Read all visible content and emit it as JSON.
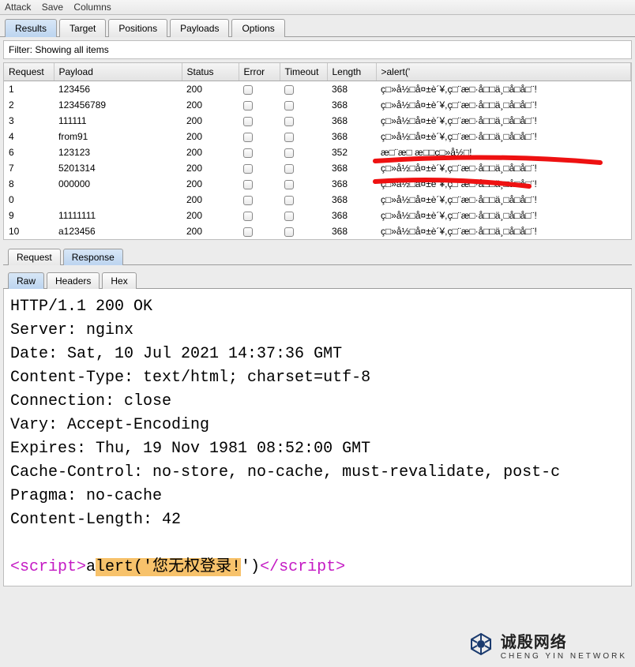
{
  "menu": {
    "items": [
      "Attack",
      "Save",
      "Columns"
    ]
  },
  "tabs": {
    "items": [
      "Results",
      "Target",
      "Positions",
      "Payloads",
      "Options"
    ],
    "active": 0
  },
  "filter": {
    "text": "Filter: Showing all items"
  },
  "columns": [
    "Request",
    "Payload",
    "Status",
    "Error",
    "Timeout",
    "Length",
    ">alert('"
  ],
  "rows": [
    {
      "request": "1",
      "payload": "123456",
      "status": "200",
      "length": "368",
      "alert": "ç□»å½□å¤±è´¥,ç□¨æ□·å□□ä¸□å­□å□¨!"
    },
    {
      "request": "2",
      "payload": "123456789",
      "status": "200",
      "length": "368",
      "alert": "ç□»å½□å¤±è´¥,ç□¨æ□·å□□ä¸□å­□å□¨!"
    },
    {
      "request": "3",
      "payload": "111111",
      "status": "200",
      "length": "368",
      "alert": "ç□»å½□å¤±è´¥,ç□¨æ□·å□□ä¸□å­□å□¨!"
    },
    {
      "request": "4",
      "payload": "from91",
      "status": "200",
      "length": "368",
      "alert": "ç□»å½□å¤±è´¥,ç□¨æ□·å□□ä¸□å­□å□¨!"
    },
    {
      "request": "6",
      "payload": "123123",
      "status": "200",
      "length": "352",
      "alert": "æ□¨æ□ æ□□ç□»å½□!"
    },
    {
      "request": "7",
      "payload": "5201314",
      "status": "200",
      "length": "368",
      "alert": "ç□»å½□å¤±è´¥,ç□¨æ□·å□□ä¸□å­□å□¨!"
    },
    {
      "request": "8",
      "payload": "000000",
      "status": "200",
      "length": "368",
      "alert": "ç□»å½□å¤±è´¥,ç□¨æ□·å□□ä¸□å­□å□¨!"
    },
    {
      "request": "0",
      "payload": "",
      "status": "200",
      "length": "368",
      "alert": "ç□»å½□å¤±è´¥,ç□¨æ□·å□□ä¸□å­□å□¨!"
    },
    {
      "request": "9",
      "payload": "11111111",
      "status": "200",
      "length": "368",
      "alert": "ç□»å½□å¤±è´¥,ç□¨æ□·å□□ä¸□å­□å□¨!"
    },
    {
      "request": "10",
      "payload": "a123456",
      "status": "200",
      "length": "368",
      "alert": "ç□»å½□å¤±è´¥,ç□¨æ□·å□□ä¸□å­□å□¨!"
    }
  ],
  "lower_tabs": {
    "items": [
      "Request",
      "Response"
    ],
    "active": 1
  },
  "view_tabs": {
    "items": [
      "Raw",
      "Headers",
      "Hex"
    ],
    "active": 0
  },
  "response": {
    "lines": [
      "HTTP/1.1 200 OK",
      "Server: nginx",
      "Date: Sat, 10 Jul 2021 14:37:36 GMT",
      "Content-Type: text/html; charset=utf-8",
      "Connection: close",
      "Vary: Accept-Encoding",
      "Expires: Thu, 19 Nov 1981 08:52:00 GMT",
      "Cache-Control: no-store, no-cache, must-revalidate, post-c",
      "Pragma: no-cache",
      "Content-Length: 42",
      ""
    ],
    "script_open": "<script>",
    "script_close": "</script>",
    "alert_prefix": "a",
    "alert_mid": "lert('您无权登录!",
    "alert_suffix": "')"
  },
  "watermark": {
    "cn": "诚殷网络",
    "en": "CHENG YIN NETWORK"
  }
}
